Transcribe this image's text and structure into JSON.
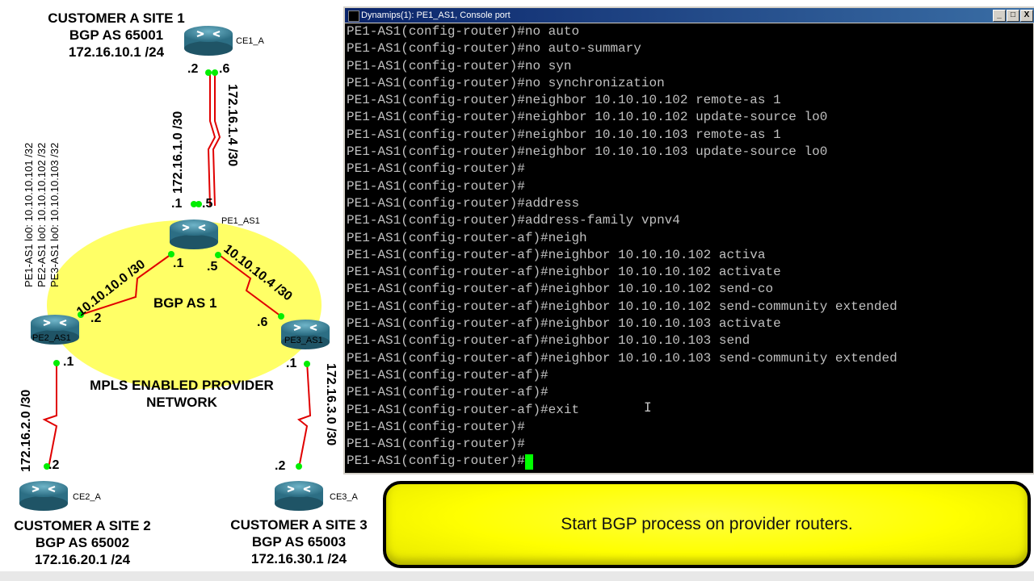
{
  "topology": {
    "site1": {
      "name": "CUSTOMER A SITE 1",
      "as": "BGP AS 65001",
      "addr": "172.16.10.1 /24"
    },
    "site2": {
      "name": "CUSTOMER A SITE 2",
      "as": "BGP AS 65002",
      "addr": "172.16.20.1 /24"
    },
    "site3": {
      "name": "CUSTOMER A SITE 3",
      "as": "BGP AS 65003",
      "addr": "172.16.30.1 /24"
    },
    "routers": {
      "ce1": "CE1_A",
      "ce2": "CE2_A",
      "ce3": "CE3_A",
      "pe1": "PE1_AS1",
      "pe2": "PE2_AS1",
      "pe3": "PE3_AS1"
    },
    "links": {
      "l1": "172.16.1.0 /30",
      "l2": "172.16.1.4 /30",
      "l3": "10.10.10.0 /30",
      "l4": "10.10.10.4 /30",
      "l5": "172.16.2.0 /30",
      "l6": "172.16.3.0 /30"
    },
    "iface": {
      "ce1_a": ".2",
      "ce1_b": ".6",
      "pe1_a": ".1",
      "pe1_b": ".5",
      "pe1_c": ".1",
      "pe1_d": ".5",
      "pe2_a": ".2",
      "pe2_b": ".1",
      "pe3_a": ".6",
      "pe3_b": ".1",
      "ce2": ".2",
      "ce3": ".2"
    },
    "loopbacks": [
      "PE1-AS1 lo0: 10.10.10.101 /32",
      "PE2-AS1 lo0: 10.10.10.102 /32",
      "PE3-AS1 lo0: 10.10.10.103 /32"
    ],
    "core_as": "BGP AS 1",
    "core_label": "MPLS ENABLED PROVIDER NETWORK",
    "core_label_1": "MPLS ENABLED PROVIDER",
    "core_label_2": "NETWORK"
  },
  "console": {
    "title": "Dynamips(1): PE1_AS1, Console port",
    "min_btn": "_",
    "max_btn": "□",
    "close_btn": "X",
    "lines": [
      "PE1-AS1(config-router)#no auto",
      "PE1-AS1(config-router)#no auto-summary",
      "PE1-AS1(config-router)#no syn",
      "PE1-AS1(config-router)#no synchronization",
      "PE1-AS1(config-router)#neighbor 10.10.10.102 remote-as 1",
      "PE1-AS1(config-router)#neighbor 10.10.10.102 update-source lo0",
      "PE1-AS1(config-router)#neighbor 10.10.10.103 remote-as 1",
      "PE1-AS1(config-router)#neighbor 10.10.10.103 update-source lo0",
      "PE1-AS1(config-router)#",
      "PE1-AS1(config-router)#",
      "PE1-AS1(config-router)#address",
      "PE1-AS1(config-router)#address-family vpnv4",
      "PE1-AS1(config-router-af)#neigh",
      "PE1-AS1(config-router-af)#neighbor 10.10.10.102 activa",
      "PE1-AS1(config-router-af)#neighbor 10.10.10.102 activate",
      "PE1-AS1(config-router-af)#neighbor 10.10.10.102 send-co",
      "PE1-AS1(config-router-af)#neighbor 10.10.10.102 send-community extended",
      "PE1-AS1(config-router-af)#neighbor 10.10.10.103 activate",
      "PE1-AS1(config-router-af)#neighbor 10.10.10.103 send",
      "PE1-AS1(config-router-af)#neighbor 10.10.10.103 send-community extended",
      "PE1-AS1(config-router-af)#",
      "PE1-AS1(config-router-af)#",
      "PE1-AS1(config-router-af)#exit",
      "PE1-AS1(config-router)#",
      "PE1-AS1(config-router)#",
      "PE1-AS1(config-router)#"
    ]
  },
  "caption": "Start BGP process on provider routers.",
  "colors": {
    "link": "#e00000",
    "dot": "#00ee00",
    "core": "#ffff66",
    "cursor": "#00ff00",
    "banner": "#ffff00"
  }
}
